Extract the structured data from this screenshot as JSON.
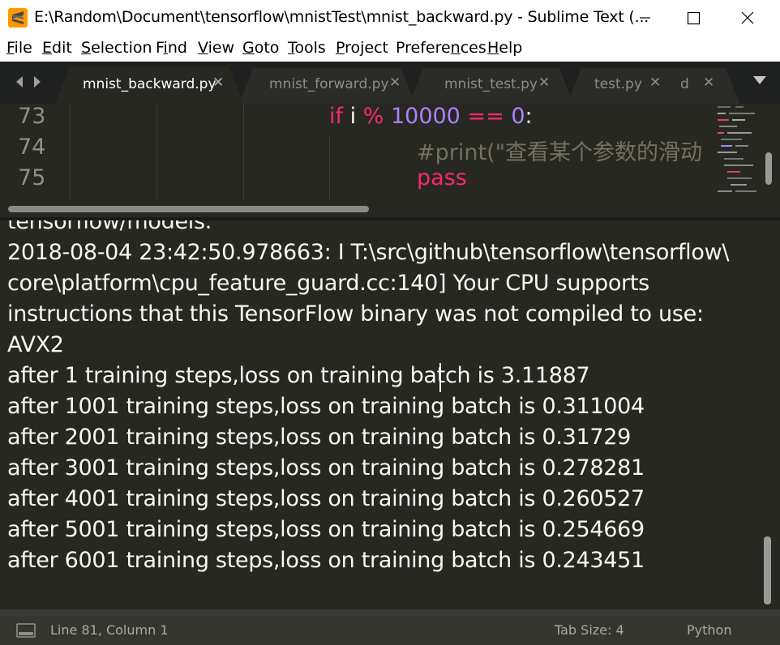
{
  "window": {
    "title": "E:\\Random\\Document\\tensorflow\\mnistTest\\mnist_backward.py - Sublime Text (..."
  },
  "menu": [
    {
      "pre": "",
      "u": "F",
      "post": "ile"
    },
    {
      "pre": "",
      "u": "E",
      "post": "dit"
    },
    {
      "pre": "",
      "u": "S",
      "post": "election"
    },
    {
      "pre": "F",
      "u": "i",
      "post": "nd"
    },
    {
      "pre": "",
      "u": "V",
      "post": "iew"
    },
    {
      "pre": "",
      "u": "G",
      "post": "oto"
    },
    {
      "pre": "",
      "u": "T",
      "post": "ools"
    },
    {
      "pre": "",
      "u": "P",
      "post": "roject"
    },
    {
      "pre": "Prefere",
      "u": "n",
      "post": "ces"
    },
    {
      "pre": "",
      "u": "H",
      "post": "elp"
    }
  ],
  "tabs": [
    {
      "label": "mnist_backward.py",
      "active": true
    },
    {
      "label": "mnist_forward.py",
      "active": false
    },
    {
      "label": "mnist_test.py",
      "active": false
    },
    {
      "label": "test.py",
      "active": false
    },
    {
      "label": "d",
      "active": false
    }
  ],
  "tab_close_glyph": "✕",
  "editor": {
    "line_numbers": [
      "73",
      "74",
      "75"
    ],
    "line73": {
      "kw_if": "if",
      "var_i": "i",
      "op_mod": "%",
      "num": "10000",
      "op_eq": "==",
      "zero": "0",
      "colon": ":"
    },
    "line74": {
      "comment": "#print(\"查看某个参数的滑动"
    },
    "line75": {
      "kw_pass": "pass"
    }
  },
  "output": {
    "partial_top": "tensorflow/models.",
    "lines": [
      "2018-08-04 23:42:50.978663: I T:\\src\\github\\tensorflow\\tensorflow\\",
      "core\\platform\\cpu_feature_guard.cc:140] Your CPU supports",
      "instructions that this TensorFlow binary was not compiled to use:",
      "AVX2",
      "after 1 training steps,loss on training batch is 3.11887",
      "after 1001 training steps,loss on training batch is 0.311004",
      "after 2001 training steps,loss on training batch is 0.31729",
      "after 3001 training steps,loss on training batch is 0.278281",
      "after 4001 training steps,loss on training batch is 0.260527",
      "after 5001 training steps,loss on training batch is 0.254669",
      "after 6001 training steps,loss on training batch is 0.243451"
    ]
  },
  "status": {
    "position": "Line 81, Column 1",
    "tab_size": "Tab Size: 4",
    "syntax": "Python"
  },
  "colors": {
    "editor_bg": "#272822",
    "keyword": "#f92672",
    "number": "#ae81ff",
    "comment": "#75715e",
    "text": "#f8f8f2"
  }
}
